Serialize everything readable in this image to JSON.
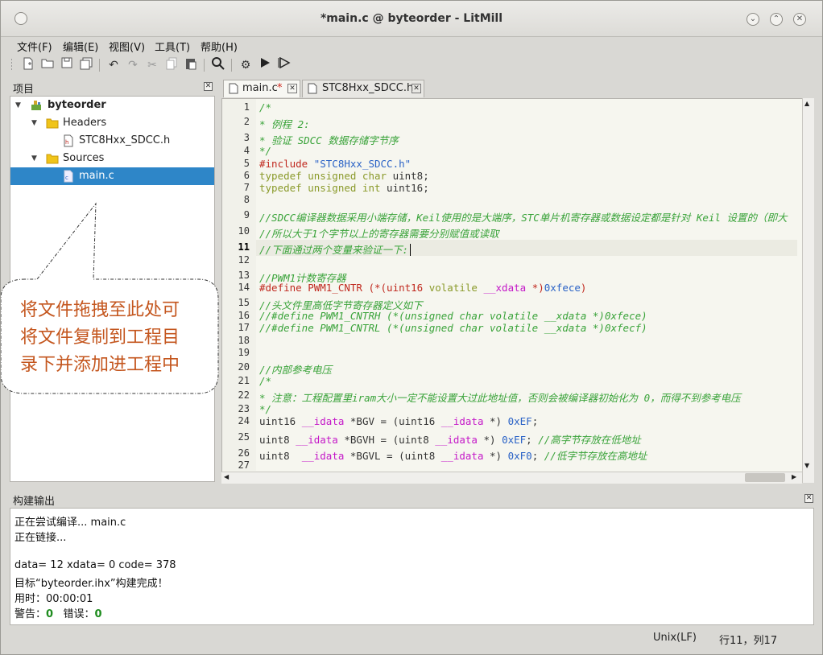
{
  "window": {
    "title": "*main.c @ byteorder - LitMill"
  },
  "menu": [
    "文件(F)",
    "编辑(E)",
    "视图(V)",
    "工具(T)",
    "帮助(H)"
  ],
  "toolbar": [
    "new-file-icon",
    "open-folder-icon",
    "save-icon",
    "save-all-icon",
    "undo-icon",
    "redo-icon",
    "cut-icon",
    "copy-icon",
    "paste-icon",
    "find-icon",
    "build-settings-icon",
    "run-icon",
    "debug-run-icon"
  ],
  "project": {
    "title": "项目",
    "root": "byteorder",
    "headers_label": "Headers",
    "header_file": "STC8Hxx_SDCC.h",
    "sources_label": "Sources",
    "source_file": "main.c"
  },
  "callout": {
    "line1": "将文件拖拽至此处可",
    "line2": "将文件复制到工程目",
    "line3": "录下并添加进工程中"
  },
  "tabs": [
    {
      "label": "main.c",
      "modified": "*"
    },
    {
      "label": "STC8Hxx_SDCC.h"
    }
  ],
  "editor": {
    "current_line": 11,
    "lines": [
      {
        "n": "1",
        "segs": [
          [
            "cm",
            "/*"
          ]
        ]
      },
      {
        "n": "2",
        "segs": [
          [
            "cm",
            "* 例程 2:"
          ]
        ]
      },
      {
        "n": "3",
        "segs": [
          [
            "cm",
            "* 验证 SDCC 数据存储字节序"
          ]
        ]
      },
      {
        "n": "4",
        "segs": [
          [
            "cm",
            "*/"
          ]
        ]
      },
      {
        "n": "5",
        "segs": [
          [
            "pp",
            "#include "
          ],
          [
            "str",
            "\"STC8Hxx_SDCC.h\""
          ]
        ]
      },
      {
        "n": "6",
        "segs": [
          [
            "kw",
            "typedef unsigned char"
          ],
          [
            "",
            "uint8;"
          ]
        ]
      },
      {
        "n": "7",
        "segs": [
          [
            "kw",
            "typedef unsigned int"
          ],
          [
            "",
            "uint16;"
          ]
        ]
      },
      {
        "n": "8",
        "segs": []
      },
      {
        "n": "9",
        "segs": [
          [
            "cm",
            "//SDCC编译器数据采用小端存储，Keil使用的是大端序，STC单片机寄存器或数据设定都是针对 Keil 设置的（即大"
          ]
        ]
      },
      {
        "n": "10",
        "segs": [
          [
            "cm",
            "//所以大于1个字节以上的寄存器需要分别赋值或读取"
          ]
        ]
      },
      {
        "n": "11",
        "segs": [
          [
            "cm",
            "//下面通过两个变量来验证一下:"
          ]
        ]
      },
      {
        "n": "12",
        "segs": []
      },
      {
        "n": "13",
        "segs": [
          [
            "cm",
            "//PWM1计数寄存器"
          ]
        ]
      },
      {
        "n": "14",
        "segs": [
          [
            "pp",
            "#define PWM1_CNTR "
          ],
          [
            "pp",
            "(*(uint16 "
          ],
          [
            "kw",
            "volatile "
          ],
          [
            "mg",
            "__xdata "
          ],
          [
            "pp",
            "*)"
          ],
          [
            "hx",
            "0xfece"
          ],
          [
            "pp",
            ")"
          ]
        ]
      },
      {
        "n": "15",
        "segs": [
          [
            "cm",
            "//头文件里高低字节寄存器定义如下"
          ]
        ]
      },
      {
        "n": "16",
        "segs": [
          [
            "cm",
            "//#define PWM1_CNTRH (*(unsigned char volatile __xdata *)0xfece)"
          ]
        ]
      },
      {
        "n": "17",
        "segs": [
          [
            "cm",
            "//#define PWM1_CNTRL (*(unsigned char volatile __xdata *)0xfecf)"
          ]
        ]
      },
      {
        "n": "18",
        "segs": []
      },
      {
        "n": "19",
        "segs": []
      },
      {
        "n": "20",
        "segs": [
          [
            "cm",
            "//内部参考电压"
          ]
        ]
      },
      {
        "n": "21",
        "segs": [
          [
            "cm",
            "/*"
          ]
        ]
      },
      {
        "n": "22",
        "segs": [
          [
            "cm",
            "* 注意：工程配置里iram大小一定不能设置大过此地址值，否则会被编译器初始化为 0，而得不到参考电压"
          ]
        ]
      },
      {
        "n": "23",
        "segs": [
          [
            "cm",
            "*/"
          ]
        ]
      },
      {
        "n": "24",
        "segs": [
          [
            "",
            "uint16 "
          ],
          [
            "mg",
            "__idata "
          ],
          [
            "",
            "*BGV = (uint16 "
          ],
          [
            "mg",
            "__idata "
          ],
          [
            "",
            "*) "
          ],
          [
            "hx",
            "0xEF"
          ],
          [
            "",
            ";"
          ]
        ]
      },
      {
        "n": "25",
        "segs": [
          [
            "",
            "uint8 "
          ],
          [
            "mg",
            "__idata "
          ],
          [
            "",
            "*BGVH = (uint8 "
          ],
          [
            "mg",
            "__idata "
          ],
          [
            "",
            "*) "
          ],
          [
            "hx",
            "0xEF"
          ],
          [
            "",
            "; "
          ],
          [
            "cm",
            "//高字节存放在低地址"
          ]
        ]
      },
      {
        "n": "26",
        "segs": [
          [
            "",
            "uint8  "
          ],
          [
            "mg",
            "__idata "
          ],
          [
            "",
            "*BGVL = (uint8 "
          ],
          [
            "mg",
            "__idata "
          ],
          [
            "",
            "*) "
          ],
          [
            "hx",
            "0xF0"
          ],
          [
            "",
            "; "
          ],
          [
            "cm",
            "//低字节存放在高地址"
          ]
        ]
      },
      {
        "n": "27",
        "segs": []
      }
    ]
  },
  "build": {
    "title": "构建输出",
    "line1": "正在尝试编译... main.c",
    "line2": "正在链接...",
    "line3": "data= 12 xdata= 0 code= 378",
    "line4": "目标“byteorder.ihx”构建完成！",
    "line5": "用时：00:00:01",
    "warn_label": "警告：",
    "warn_count": "0",
    "err_label": "错误：",
    "err_count": "0"
  },
  "status": {
    "eol": "Unix(LF)",
    "position": "行11，列17"
  }
}
